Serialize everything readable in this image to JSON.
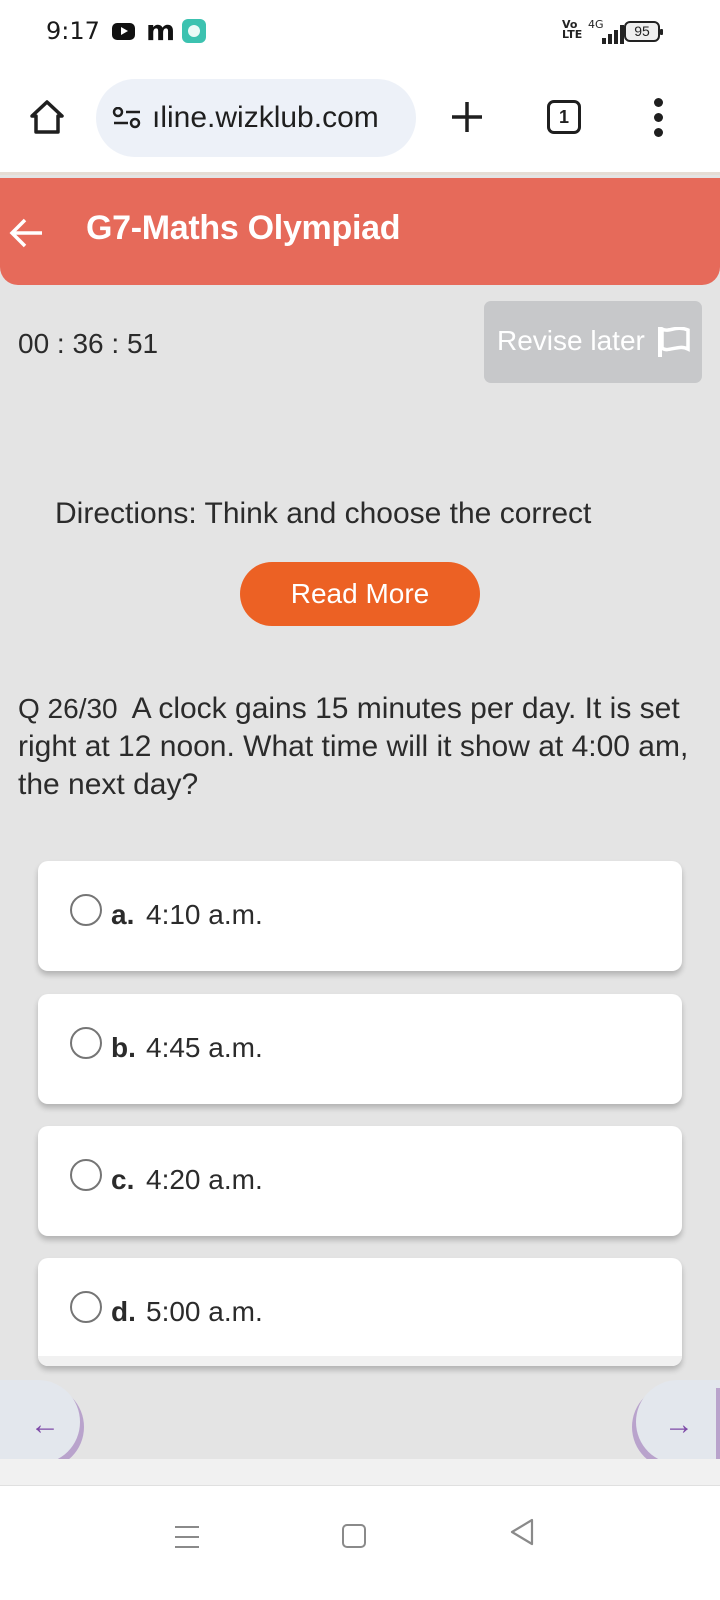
{
  "status_bar": {
    "time": "9:17",
    "notification_icons": [
      "youtube-icon",
      "m-app-icon",
      "teal-app-icon"
    ],
    "volte_label": "Vo\nLTE",
    "network": "4G",
    "battery": "95"
  },
  "browser": {
    "url": "ıline.wizklub.com",
    "tab_count": "1",
    "icons": {
      "home": "home-icon",
      "site_settings": "tune-icon",
      "new_tab": "plus-icon",
      "tabs": "tab-switcher-icon",
      "menu": "more-vert-icon"
    }
  },
  "header": {
    "title": "G7-Maths Olympiad",
    "back_icon": "arrow-left-icon",
    "background_color": "#e66a5a"
  },
  "quiz": {
    "timer": "00 : 36 : 51",
    "revise_later_label": "Revise later",
    "revise_later_icon": "flag-icon",
    "directions": "Directions: Think and choose the correct option.",
    "read_more_label": "Read More",
    "read_more_color": "#ec6124",
    "question_number": "Q 26/30",
    "question_text": "A clock gains 15 minutes per day. It is set right at 12 noon. What time will it show at 4:00 am, the next day?",
    "options": [
      {
        "letter": "a.",
        "text": "4:10 a.m.",
        "selected": false
      },
      {
        "letter": "b.",
        "text": "4:45 a.m.",
        "selected": false
      },
      {
        "letter": "c.",
        "text": "4:20 a.m.",
        "selected": false
      },
      {
        "letter": "d.",
        "text": "5:00 a.m.",
        "selected": false
      }
    ],
    "nav": {
      "prev_arrow": "←",
      "next_arrow": "→",
      "accent_color": "#7e4aa8"
    }
  },
  "system_nav": {
    "buttons": [
      "recents-icon",
      "home-icon",
      "back-icon"
    ]
  }
}
